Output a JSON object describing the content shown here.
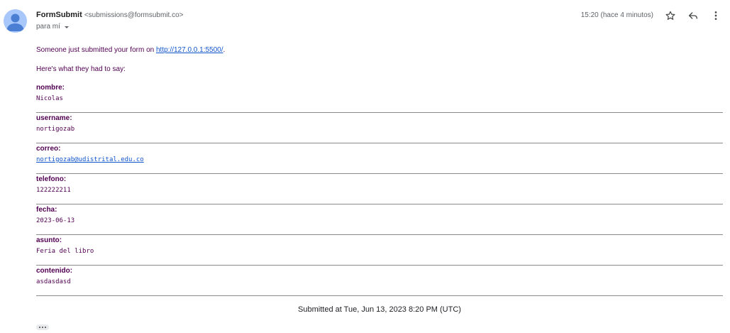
{
  "header": {
    "sender_name": "FormSubmit",
    "sender_email": "<submissions@formsubmit.co>",
    "recipient": "para mí",
    "timestamp": "15:20 (hace 4 minutos)",
    "icons": [
      "star-icon",
      "reply-icon",
      "more-vert-icon",
      "chevron-down-icon",
      "avatar-person-icon"
    ]
  },
  "body": {
    "intro_text": "Someone just submitted your form on ",
    "intro_link": "http://127.0.0.1:5500/",
    "intro_end": ".",
    "subheading": "Here's what they had to say:",
    "fields": [
      {
        "label": "nombre:",
        "value": "Nicolas"
      },
      {
        "label": "username:",
        "value": "nortigozab"
      },
      {
        "label": "correo:",
        "value": "nortigozab@udistrital.edu.co"
      },
      {
        "label": "telefono:",
        "value": "122222211"
      },
      {
        "label": "fecha:",
        "value": "2023-06-13"
      },
      {
        "label": "asunto:",
        "value": "Feria del libro"
      },
      {
        "label": "contenido:",
        "value": "asdasdasd"
      }
    ],
    "footer": "Submitted at Tue, Jun 13, 2023 8:20 PM (UTC)"
  },
  "colors": {
    "body_text": "#500050",
    "link": "#1155cc",
    "avatar": "#a8c7fa",
    "avatar_figure": "#4a7fd4"
  }
}
